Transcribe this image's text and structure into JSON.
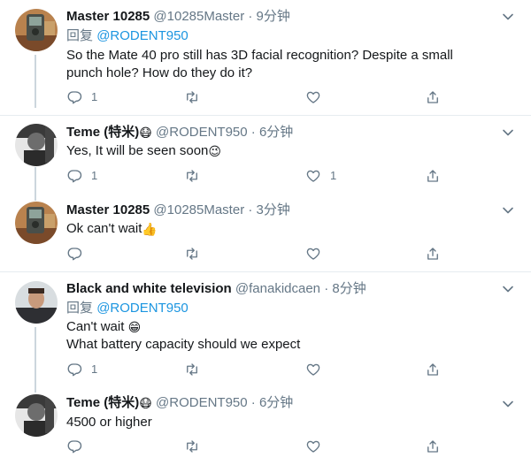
{
  "tweets": [
    {
      "name": "Master 10285",
      "handle": "@10285Master",
      "dot": "·",
      "time": "9分钟",
      "reply_prefix": "回复",
      "reply_to": "@RODENT950",
      "lines": [
        "So the Mate 40 pro still has 3D facial recognition?  Despite a small",
        "punch hole?  How do they do it?"
      ],
      "reply_count": "1",
      "retweet_count": "",
      "like_count": ""
    },
    {
      "name": "Teme (特米)",
      "name_emoji": "😷",
      "handle": "@RODENT950",
      "dot": "·",
      "time": "6分钟",
      "lines": [
        "Yes, It will be seen soon"
      ],
      "text_emoji": "😉",
      "reply_count": "1",
      "retweet_count": "",
      "like_count": "1"
    },
    {
      "name": "Master 10285",
      "handle": "@10285Master",
      "dot": "·",
      "time": "3分钟",
      "lines": [
        "Ok can't wait"
      ],
      "text_emoji": "👍",
      "reply_count": "",
      "retweet_count": "",
      "like_count": ""
    },
    {
      "name": "Black and white television",
      "handle": "@fanakidcaen",
      "dot": "·",
      "time": "8分钟",
      "reply_prefix": "回复",
      "reply_to": "@RODENT950",
      "lines": [
        "Can't wait ",
        "What battery capacity should we expect"
      ],
      "text_emoji": "😁",
      "reply_count": "1",
      "retweet_count": "",
      "like_count": ""
    },
    {
      "name": "Teme (特米)",
      "name_emoji": "😷",
      "handle": "@RODENT950",
      "dot": "·",
      "time": "6分钟",
      "lines": [
        "4500 or higher"
      ],
      "reply_count": "",
      "retweet_count": "",
      "like_count": ""
    }
  ],
  "icons": {
    "reply": "reply-icon",
    "retweet": "retweet-icon",
    "like": "like-icon",
    "share": "share-icon",
    "caret": "chevron-down-icon"
  },
  "colors": {
    "text": "#14171a",
    "secondary": "#657786",
    "link": "#1b95e0",
    "divider": "#e6ecf0",
    "thread": "#ccd6dd"
  }
}
